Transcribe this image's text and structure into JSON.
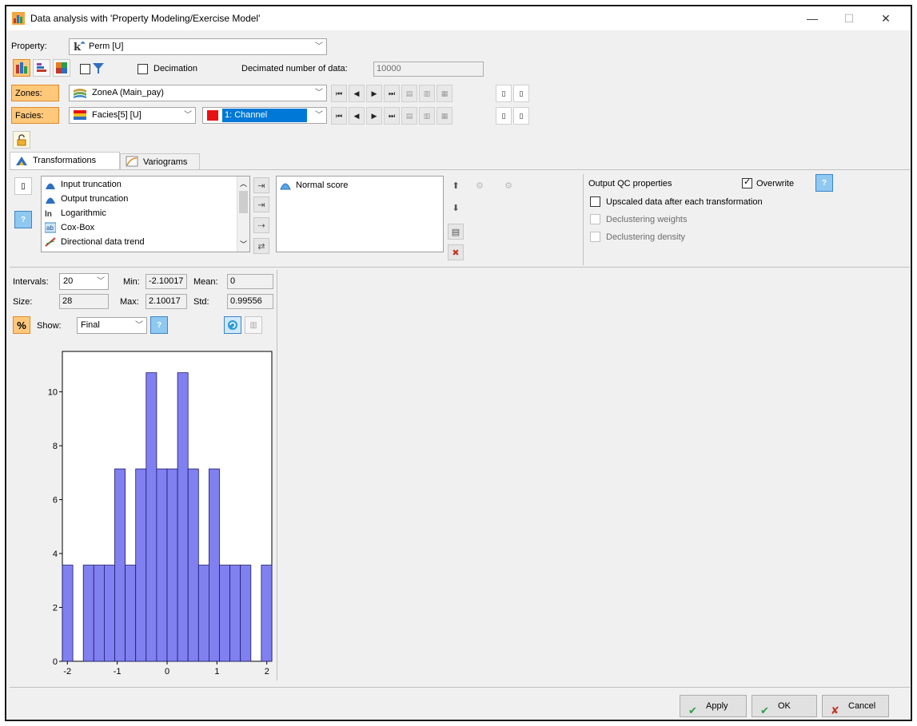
{
  "window": {
    "title": "Data analysis with 'Property Modeling/Exercise Model'",
    "minimize": "—",
    "maximize": "☐",
    "close": "✕"
  },
  "property": {
    "label": "Property:",
    "value": "Perm [U]"
  },
  "decimation": {
    "checkbox_label": "Decimation",
    "count_label": "Decimated number of data:",
    "count_value": "10000"
  },
  "zones": {
    "label": "Zones:",
    "value": "ZoneA (Main_pay)"
  },
  "facies": {
    "label": "Facies:",
    "property": "Facies[5] [U]",
    "code": "1: Channel",
    "code_color": "#e81010"
  },
  "tabs": [
    {
      "label": "Transformations"
    },
    {
      "label": "Variograms"
    }
  ],
  "transform_list": [
    "Input truncation",
    "Output truncation",
    "Logarithmic",
    "Cox-Box",
    "Directional data trend"
  ],
  "applied_list": [
    "Normal score"
  ],
  "output_qc": {
    "label": "Output QC properties",
    "overwrite_label": "Overwrite",
    "overwrite_checked": true,
    "options": [
      {
        "label": "Upscaled data after each transformation",
        "enabled": true,
        "checked": false
      },
      {
        "label": "Declustering weights",
        "enabled": false,
        "checked": false
      },
      {
        "label": "Declustering density",
        "enabled": false,
        "checked": false
      }
    ]
  },
  "stats": {
    "intervals_label": "Intervals:",
    "intervals_value": "20",
    "min_label": "Min:",
    "min_value": "-2.10017",
    "mean_label": "Mean:",
    "mean_value": "0",
    "size_label": "Size:",
    "size_value": "28",
    "max_label": "Max:",
    "max_value": "2.10017",
    "std_label": "Std:",
    "std_value": "0.99556",
    "show_label": "Show:",
    "show_value": "Final"
  },
  "chart_data": {
    "type": "bar",
    "title": "",
    "xlabel": "",
    "ylabel": "",
    "xlim": [
      -2.10017,
      2.10017
    ],
    "ylim": [
      0,
      11.5
    ],
    "xticks": [
      -2,
      -1,
      0,
      1,
      2
    ],
    "yticks": [
      0,
      2,
      4,
      6,
      8,
      10
    ],
    "bin_count": 20,
    "values": [
      3.57,
      0,
      3.57,
      3.57,
      3.57,
      7.14,
      3.57,
      7.14,
      10.71,
      7.14,
      7.14,
      10.71,
      7.14,
      3.57,
      7.14,
      3.57,
      3.57,
      3.57,
      0,
      3.57
    ],
    "bar_color": "#8080f0",
    "grid": false
  },
  "buttons": {
    "apply": "Apply",
    "ok": "OK",
    "cancel": "Cancel"
  }
}
